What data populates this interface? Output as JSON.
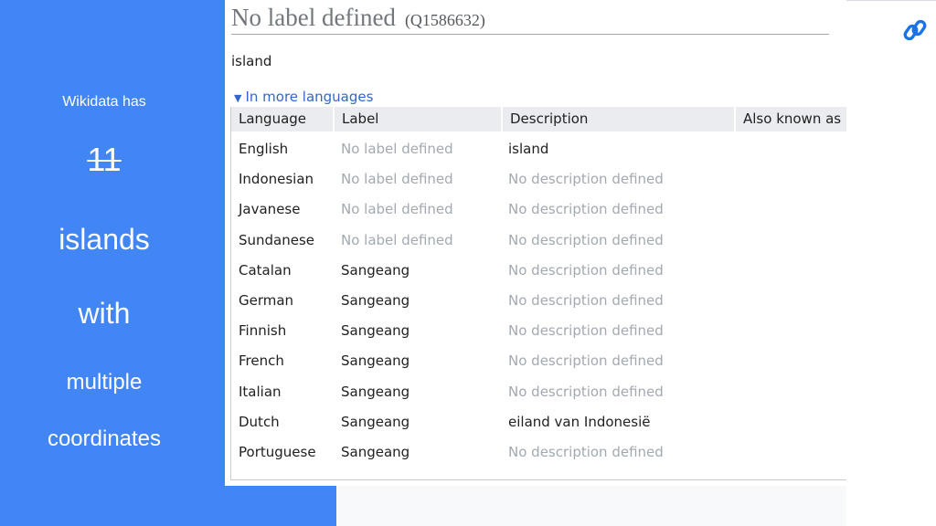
{
  "slide": {
    "line1": "Wikidata has",
    "count": "11",
    "line2": "islands",
    "line3": "with",
    "line4": "multiple",
    "line5": "coordinates",
    "accent_color": "#4285f4"
  },
  "item": {
    "label": "No label defined",
    "qid": "(Q1586632)",
    "description": "island"
  },
  "languages_toggle": "In more languages",
  "table": {
    "headers": [
      "Language",
      "Label",
      "Description",
      "Also known as"
    ],
    "rows": [
      {
        "language": "English",
        "label": "No label defined",
        "description": "island",
        "label_missing": true,
        "desc_missing": false
      },
      {
        "language": "Indonesian",
        "label": "No label defined",
        "description": "No description defined",
        "label_missing": true,
        "desc_missing": true
      },
      {
        "language": "Javanese",
        "label": "No label defined",
        "description": "No description defined",
        "label_missing": true,
        "desc_missing": true
      },
      {
        "language": "Sundanese",
        "label": "No label defined",
        "description": "No description defined",
        "label_missing": true,
        "desc_missing": true
      },
      {
        "language": "Catalan",
        "label": "Sangeang",
        "description": "No description defined",
        "label_missing": false,
        "desc_missing": true
      },
      {
        "language": "German",
        "label": "Sangeang",
        "description": "No description defined",
        "label_missing": false,
        "desc_missing": true
      },
      {
        "language": "Finnish",
        "label": "Sangeang",
        "description": "No description defined",
        "label_missing": false,
        "desc_missing": true
      },
      {
        "language": "French",
        "label": "Sangeang",
        "description": "No description defined",
        "label_missing": false,
        "desc_missing": true
      },
      {
        "language": "Italian",
        "label": "Sangeang",
        "description": "No description defined",
        "label_missing": false,
        "desc_missing": true
      },
      {
        "language": "Dutch",
        "label": "Sangeang",
        "description": "eiland van Indonesië",
        "label_missing": false,
        "desc_missing": false
      },
      {
        "language": "Portuguese",
        "label": "Sangeang",
        "description": "No description defined",
        "label_missing": false,
        "desc_missing": true
      }
    ]
  },
  "icons": {
    "toggle": "triangle-down-icon",
    "corner": "link-icon",
    "corner_color": "#1a73e8"
  }
}
